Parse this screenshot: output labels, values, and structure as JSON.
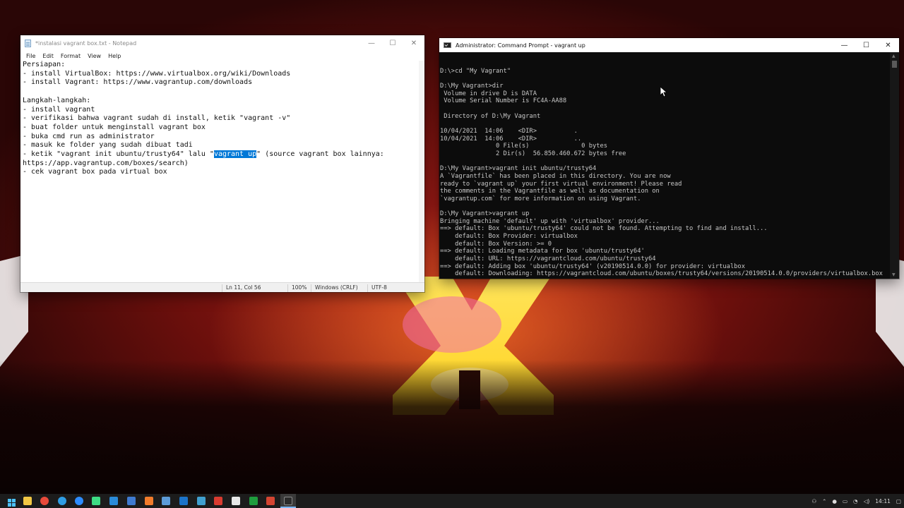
{
  "notepad": {
    "title": "*instalasi vagrant box.txt - Notepad",
    "menu": [
      "File",
      "Edit",
      "Format",
      "View",
      "Help"
    ],
    "lines_before": "Persiapan:\n- install VirtualBox: https://www.virtualbox.org/wiki/Downloads\n- install Vagrant: https://www.vagrantup.com/downloads\n\nLangkah-langkah:\n- install vagrant\n- verifikasi bahwa vagrant sudah di install, ketik \"vagrant -v\"\n- buat folder untuk menginstall vagrant box\n- buka cmd run as administrator\n- masuk ke folder yang sudah dibuat tadi\n- ketik \"vagrant init ubuntu/trusty64\" lalu \"",
    "selected_text": "vagrant up",
    "lines_after": "\" (source vagrant box lainnya:\nhttps://app.vagrantup.com/boxes/search)\n- cek vagrant box pada virtual box",
    "status": {
      "position": "Ln 11, Col 56",
      "zoom": "100%",
      "line_ending": "Windows (CRLF)",
      "encoding": "UTF-8"
    }
  },
  "cmd": {
    "title": "Administrator: Command Prompt - vagrant  up",
    "output": "\nD:\\>cd \"My Vagrant\"\n\nD:\\My Vagrant>dir\n Volume in drive D is DATA\n Volume Serial Number is FC4A-AA88\n\n Directory of D:\\My Vagrant\n\n10/04/2021  14:06    <DIR>          .\n10/04/2021  14:06    <DIR>          ..\n               0 File(s)              0 bytes\n               2 Dir(s)  56.850.460.672 bytes free\n\nD:\\My Vagrant>vagrant init ubuntu/trusty64\nA `Vagrantfile` has been placed in this directory. You are now\nready to `vagrant up` your first virtual environment! Please read\nthe comments in the Vagrantfile as well as documentation on\n`vagrantup.com` for more information on using Vagrant.\n\nD:\\My Vagrant>vagrant up\nBringing machine 'default' up with 'virtualbox' provider...\n==> default: Box 'ubuntu/trusty64' could not be found. Attempting to find and install...\n    default: Box Provider: virtualbox\n    default: Box Version: >= 0\n==> default: Loading metadata for box 'ubuntu/trusty64'\n    default: URL: https://vagrantcloud.com/ubuntu/trusty64\n==> default: Adding box 'ubuntu/trusty64' (v20190514.0.0) for provider: virtualbox\n    default: Downloading: https://vagrantcloud.com/ubuntu/boxes/trusty64/versions/20190514.0.0/providers/virtualbox.box\n_"
  },
  "caption": {
    "minimize": "—",
    "maximize": "☐",
    "close": "✕"
  },
  "taskbar": {
    "clock": "14:11",
    "colors": {
      "start": "#4cc2ff",
      "explorer": "#f2c744",
      "chrome": "#e84a3b",
      "edge": "#2f9de4",
      "zoom": "#2d8cff",
      "android": "#3ddc84",
      "vscode": "#2a8ad8",
      "virtualbox": "#3f7ad0",
      "generic1": "#f27b2b",
      "generic2": "#5c9bd8",
      "outlook": "#1c73c9",
      "generic3": "#40a0d0",
      "adobe": "#d93b30",
      "generic4": "#e8e8e8",
      "excel-like": "#1f9d3e",
      "red": "#d44532",
      "cmd": "#2b2b2b"
    }
  }
}
